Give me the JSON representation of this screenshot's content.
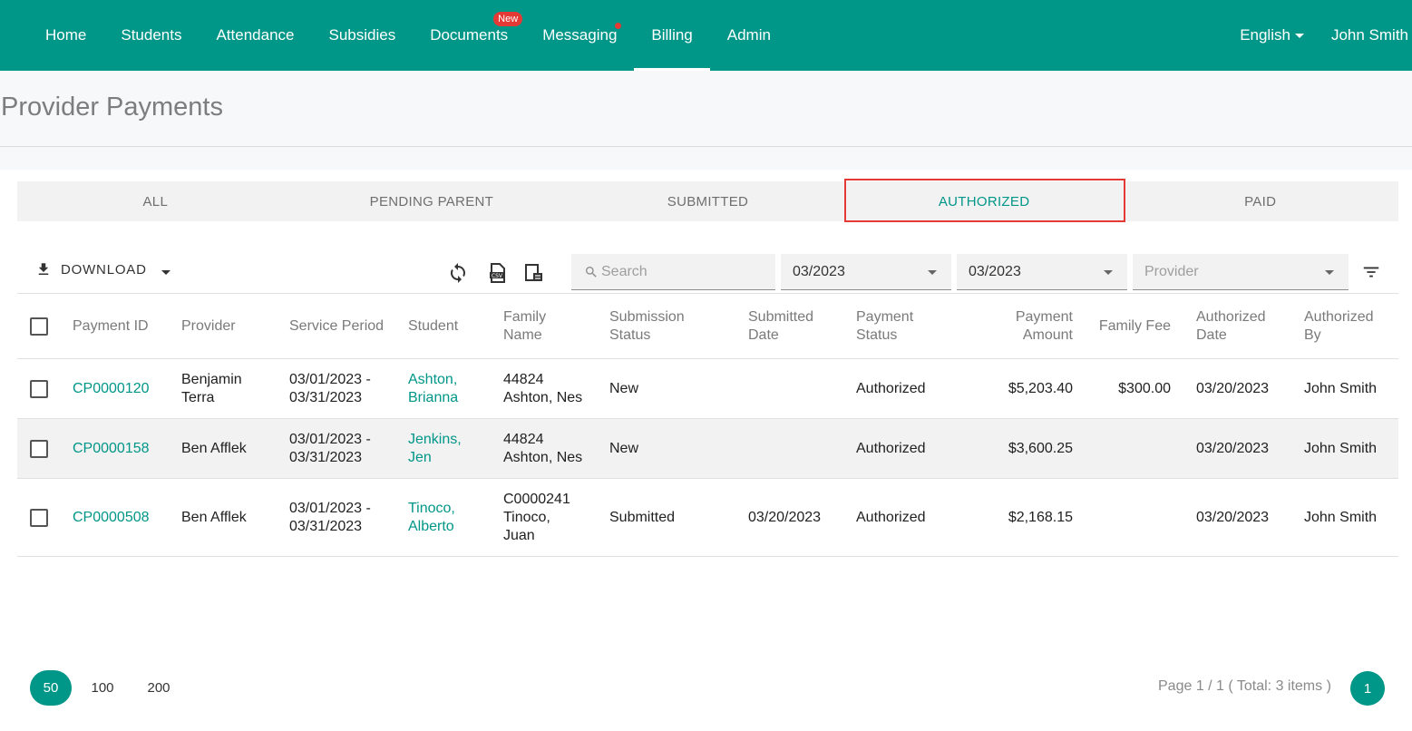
{
  "nav": {
    "items": [
      {
        "label": "Home",
        "badge": "",
        "dot": false,
        "active": false
      },
      {
        "label": "Students",
        "badge": "",
        "dot": false,
        "active": false
      },
      {
        "label": "Attendance",
        "badge": "",
        "dot": false,
        "active": false
      },
      {
        "label": "Subsidies",
        "badge": "",
        "dot": false,
        "active": false
      },
      {
        "label": "Documents",
        "badge": "New",
        "dot": false,
        "active": false
      },
      {
        "label": "Messaging",
        "badge": "",
        "dot": true,
        "active": false
      },
      {
        "label": "Billing",
        "badge": "",
        "dot": false,
        "active": true
      },
      {
        "label": "Admin",
        "badge": "",
        "dot": false,
        "active": false
      }
    ],
    "language": "English",
    "user": "John Smith",
    "colors": {
      "bar": "#009688",
      "badge": "#e53935"
    }
  },
  "page": {
    "title": "Provider Payments"
  },
  "tabs": {
    "items": [
      "ALL",
      "PENDING PARENT",
      "SUBMITTED",
      "AUTHORIZED",
      "PAID"
    ],
    "active_index": 3
  },
  "toolbar": {
    "download_label": "DOWNLOAD",
    "search_placeholder": "Search",
    "from_period": "03/2023",
    "to_period": "03/2023",
    "provider_placeholder": "Provider",
    "icons": [
      "refresh-icon",
      "csv-file-icon",
      "export-file-icon",
      "filter-list-icon"
    ]
  },
  "table": {
    "headers": {
      "payment_id": "Payment ID",
      "provider": "Provider",
      "service_period": "Service Period",
      "student": "Student",
      "family_name": [
        "Family",
        "Name"
      ],
      "submission_status": [
        "Submission",
        "Status"
      ],
      "submitted_date": [
        "Submitted",
        "Date"
      ],
      "payment_status": [
        "Payment",
        "Status"
      ],
      "payment_amount": [
        "Payment",
        "Amount"
      ],
      "family_fee": "Family Fee",
      "authorized_date": [
        "Authorized",
        "Date"
      ],
      "authorized_by": [
        "Authorized",
        "By"
      ]
    },
    "rows": [
      {
        "payment_id": "CP0000120",
        "provider": [
          "Benjamin",
          "Terra"
        ],
        "service_period": [
          "03/01/2023 -",
          "03/31/2023"
        ],
        "student": [
          "Ashton,",
          "Brianna"
        ],
        "family_name": [
          "44824",
          "Ashton, Nes"
        ],
        "submission_status": "New",
        "submitted_date": "",
        "payment_status": "Authorized",
        "payment_amount": "$5,203.40",
        "family_fee": "$300.00",
        "authorized_date": "03/20/2023",
        "authorized_by": "John Smith"
      },
      {
        "payment_id": "CP0000158",
        "provider": [
          "Ben Afflek"
        ],
        "service_period": [
          "03/01/2023 -",
          "03/31/2023"
        ],
        "student": [
          "Jenkins,",
          "Jen"
        ],
        "family_name": [
          "44824",
          "Ashton, Nes"
        ],
        "submission_status": "New",
        "submitted_date": "",
        "payment_status": "Authorized",
        "payment_amount": "$3,600.25",
        "family_fee": "",
        "authorized_date": "03/20/2023",
        "authorized_by": "John Smith"
      },
      {
        "payment_id": "CP0000508",
        "provider": [
          "Ben Afflek"
        ],
        "service_period": [
          "03/01/2023 -",
          "03/31/2023"
        ],
        "student": [
          "Tinoco,",
          "Alberto"
        ],
        "family_name": [
          "C0000241",
          "Tinoco,",
          "Juan"
        ],
        "submission_status": "Submitted",
        "submitted_date": "03/20/2023",
        "payment_status": "Authorized",
        "payment_amount": "$2,168.15",
        "family_fee": "",
        "authorized_date": "03/20/2023",
        "authorized_by": "John Smith"
      }
    ]
  },
  "pagination": {
    "sizes": [
      "50",
      "100",
      "200"
    ],
    "active_size": "50",
    "info": "Page 1 / 1 ( Total: 3 items )",
    "current_page": "1"
  }
}
